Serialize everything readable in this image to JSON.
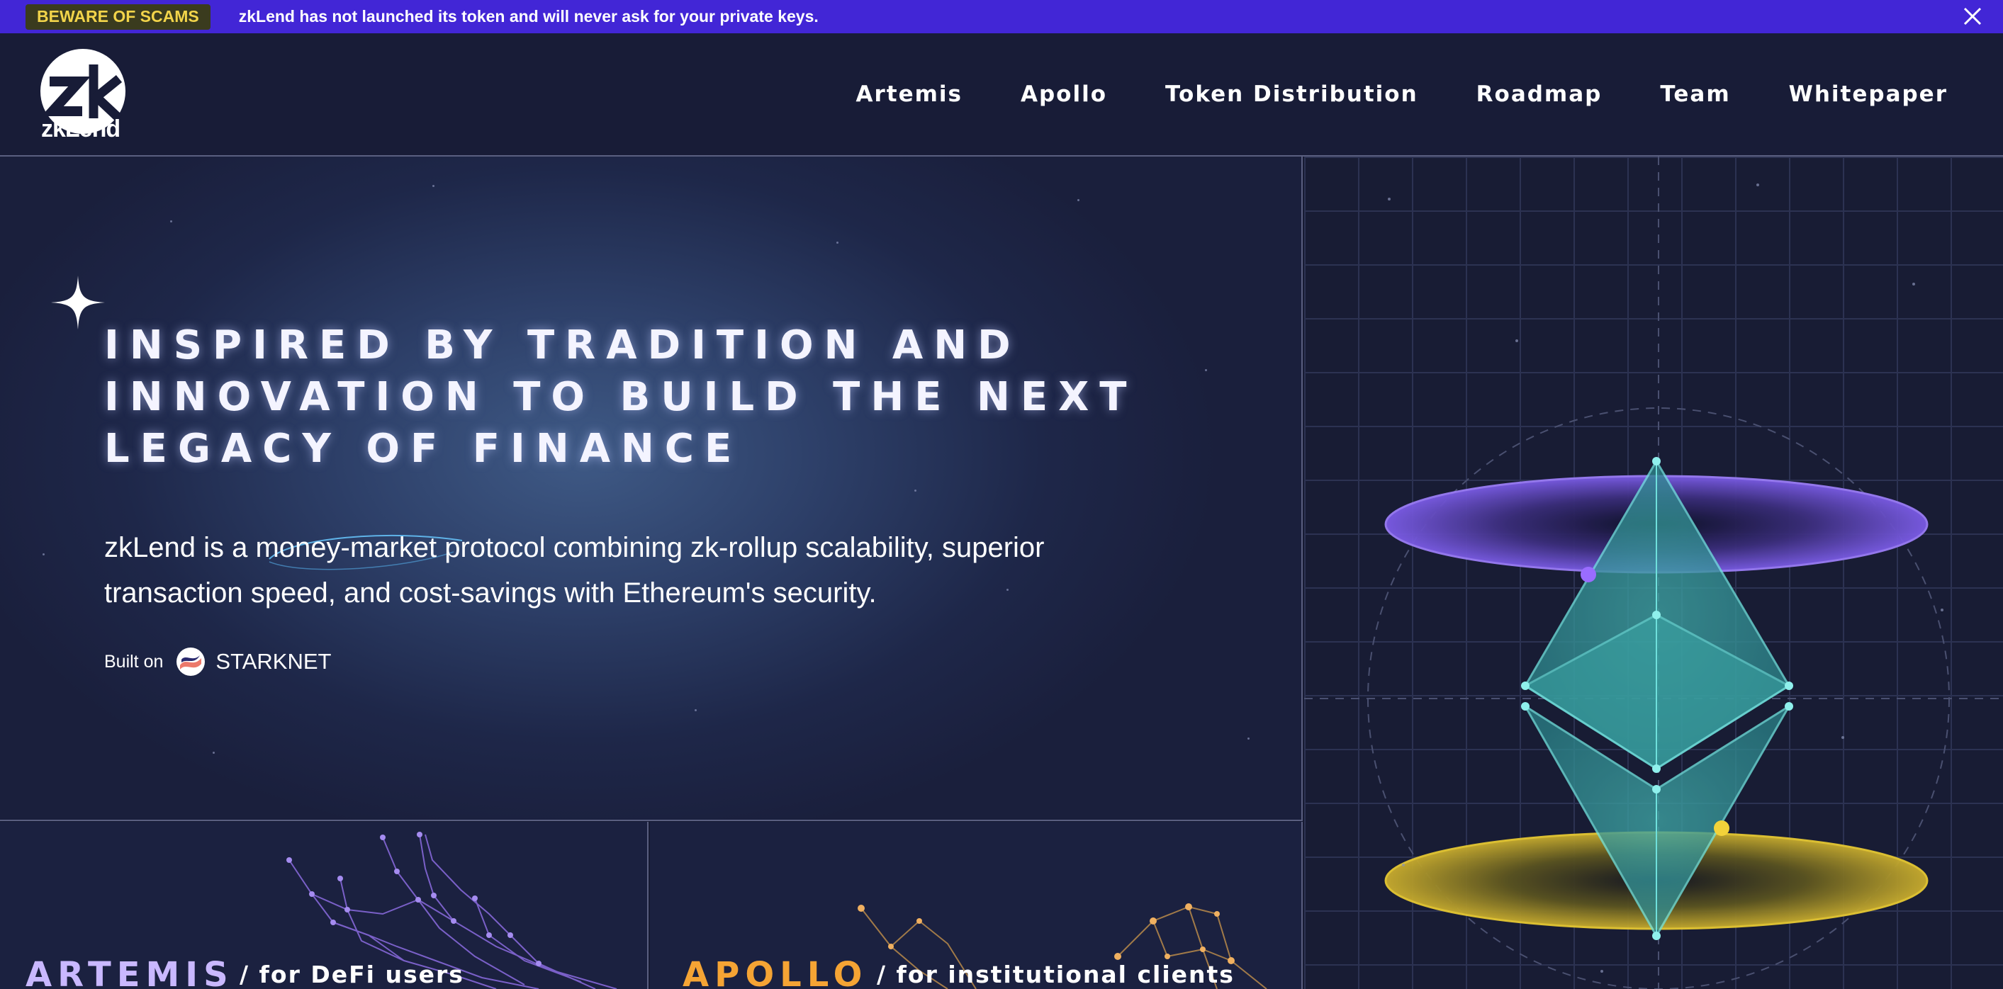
{
  "banner": {
    "badge": "BEWARE OF SCAMS",
    "message": "zkLend has not launched its token and will never ask for your private keys."
  },
  "header": {
    "logo_text": "zkLend",
    "nav": [
      "Artemis",
      "Apollo",
      "Token Distribution",
      "Roadmap",
      "Team",
      "Whitepaper"
    ]
  },
  "hero": {
    "headline": [
      "INSPIRED BY TRADITION AND",
      "INNOVATION TO BUILD THE NEXT",
      "LEGACY OF FINANCE"
    ],
    "description": "zkLend is a money-market protocol combining zk-rollup scalability, superior transaction speed, and cost-savings with Ethereum's security.",
    "built_on_label": "Built on",
    "built_on_brand": "STARKNET"
  },
  "cards": {
    "artemis": {
      "title": "ARTEMIS",
      "subtitle": "/ for DeFi users",
      "color": "#c9b8ff"
    },
    "apollo": {
      "title": "APOLLO",
      "subtitle": "/ for institutional clients",
      "color": "#f5a434"
    }
  },
  "colors": {
    "banner_bg": "#4226d6",
    "badge_text": "#f2d44a",
    "eth_teal": "#4fc3c3",
    "ring_purple": "#7b5ce6",
    "ring_yellow": "#e6c832"
  },
  "icons": [
    "close-icon",
    "zk-logo-icon",
    "sparkle-icon",
    "starknet-icon",
    "ethereum-icon"
  ]
}
